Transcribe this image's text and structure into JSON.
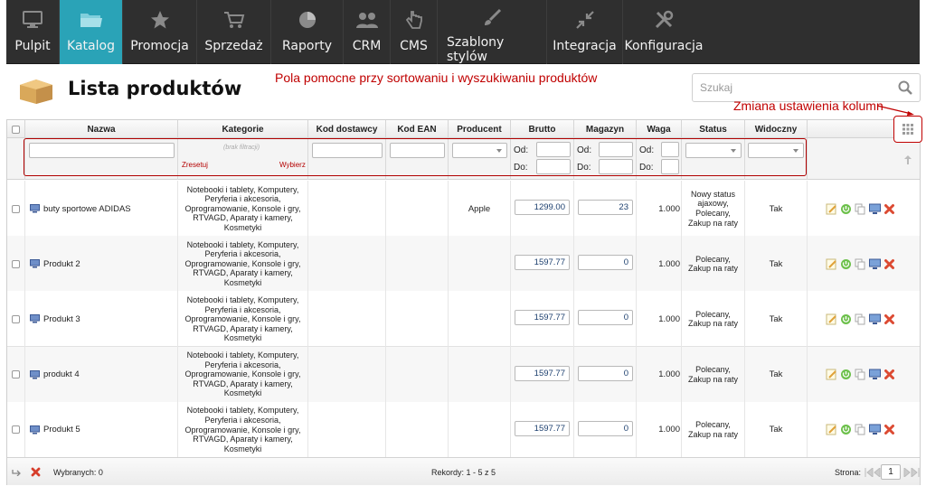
{
  "nav": {
    "items": [
      {
        "label": "Pulpit",
        "icon": "monitor-icon"
      },
      {
        "label": "Katalog",
        "icon": "folder-icon",
        "active": true
      },
      {
        "label": "Promocja",
        "icon": "star-icon"
      },
      {
        "label": "Sprzedaż",
        "icon": "cart-icon"
      },
      {
        "label": "Raporty",
        "icon": "pie-chart-icon"
      },
      {
        "label": "CRM",
        "icon": "users-icon"
      },
      {
        "label": "CMS",
        "icon": "hand-pointer-icon"
      },
      {
        "label": "Szablony stylów",
        "icon": "brush-icon"
      },
      {
        "label": "Integracja",
        "icon": "arrows-icon"
      },
      {
        "label": "Konfiguracja",
        "icon": "tools-icon"
      }
    ],
    "active_color": "#2aa3b7"
  },
  "header": {
    "title": "Lista produktów",
    "annotation_filters": "Pola pomocne przy sortowaniu i wyszukiwaniu produktów",
    "annotation_columns": "Zmiana ustawienia kolumn",
    "search_placeholder": "Szukaj"
  },
  "grid": {
    "columns": [
      "Nazwa",
      "Kategorie",
      "Kod dostawcy",
      "Kod EAN",
      "Producent",
      "Brutto",
      "Magazyn",
      "Waga",
      "Status",
      "Widoczny"
    ],
    "filters": {
      "no_filter": "(brak filtracji)",
      "reset": "Zresetuj",
      "choose": "Wybierz",
      "from": "Od:",
      "to": "Do:"
    },
    "rows": [
      {
        "name": "buty sportowe ADIDAS",
        "categories": "Notebooki i tablety, Komputery, Peryferia i akcesoria, Oprogramowanie, Konsole i gry, RTVAGD, Aparaty i kamery, Kosmetyki",
        "supplier_code": "",
        "ean": "",
        "producer": "Apple",
        "gross": "1299.00",
        "stock": "23",
        "weight": "1.000",
        "status": "Nowy status ajaxowy, Polecany, Zakup na raty",
        "visible": "Tak"
      },
      {
        "name": "Produkt 2",
        "categories": "Notebooki i tablety, Komputery, Peryferia i akcesoria, Oprogramowanie, Konsole i gry, RTVAGD, Aparaty i kamery, Kosmetyki",
        "supplier_code": "",
        "ean": "",
        "producer": "",
        "gross": "1597.77",
        "stock": "0",
        "weight": "1.000",
        "status": "Polecany, Zakup na raty",
        "visible": "Tak"
      },
      {
        "name": "Produkt 3",
        "categories": "Notebooki i tablety, Komputery, Peryferia i akcesoria, Oprogramowanie, Konsole i gry, RTVAGD, Aparaty i kamery, Kosmetyki",
        "supplier_code": "",
        "ean": "",
        "producer": "",
        "gross": "1597.77",
        "stock": "0",
        "weight": "1.000",
        "status": "Polecany, Zakup na raty",
        "visible": "Tak"
      },
      {
        "name": "produkt 4",
        "categories": "Notebooki i tablety, Komputery, Peryferia i akcesoria, Oprogramowanie, Konsole i gry, RTVAGD, Aparaty i kamery, Kosmetyki",
        "supplier_code": "",
        "ean": "",
        "producer": "",
        "gross": "1597.77",
        "stock": "0",
        "weight": "1.000",
        "status": "Polecany, Zakup na raty",
        "visible": "Tak"
      },
      {
        "name": "Produkt 5",
        "categories": "Notebooki i tablety, Komputery, Peryferia i akcesoria, Oprogramowanie, Konsole i gry, RTVAGD, Aparaty i kamery, Kosmetyki",
        "supplier_code": "",
        "ean": "",
        "producer": "",
        "gross": "1597.77",
        "stock": "0",
        "weight": "1.000",
        "status": "Polecany, Zakup na raty",
        "visible": "Tak"
      }
    ],
    "row_actions": [
      "edit-icon",
      "toggle-status-icon",
      "copy-icon",
      "preview-icon",
      "delete-icon"
    ]
  },
  "footer": {
    "selected": "Wybranych: 0",
    "records": "Rekordy: 1 - 5 z 5",
    "page_label": "Strona:",
    "page_value": "1"
  }
}
